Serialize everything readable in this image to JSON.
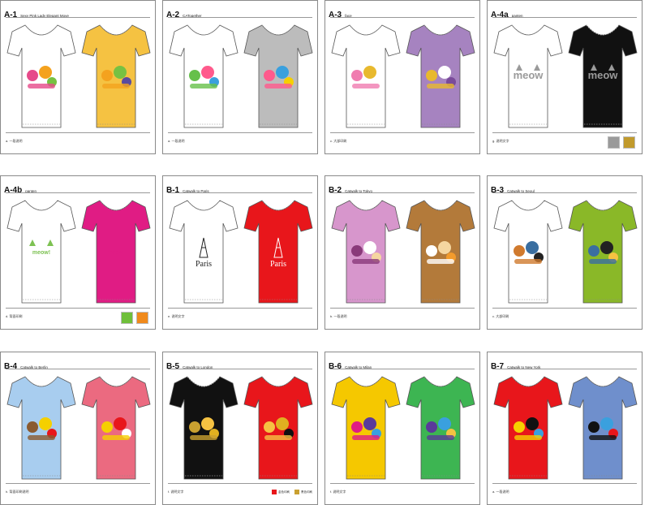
{
  "cards": [
    {
      "code": "A-1",
      "subtitle": "Sexy Pink Lady Elegant Move",
      "footer": "a. 一段说明",
      "shirts": [
        "#ffffff",
        "#f5c242"
      ],
      "art": "flowers"
    },
    {
      "code": "A-2",
      "subtitle": "CATogether",
      "footer": "a. 一段说明",
      "shirts": [
        "#ffffff",
        "#bcbcbc"
      ],
      "art": "cats"
    },
    {
      "code": "A-3",
      "subtitle": "face",
      "footer": "c. 大部印刷",
      "shirts": [
        "#ffffff",
        "#a683c0"
      ],
      "art": "catface"
    },
    {
      "code": "A-4a",
      "subtitle": "panten",
      "footer": "g. 说明文字",
      "shirts": [
        "#ffffff",
        "#111111"
      ],
      "art": "meow",
      "swatches": [
        "#9a9a9a",
        "#c19a2c"
      ]
    },
    {
      "code": "A-4b",
      "subtitle": "panten",
      "footer": "d. 背面印刷",
      "shirts": [
        "#ffffff",
        "#e01c84"
      ],
      "art": "meow2",
      "swatches": [
        "#6fbf3a",
        "#f08a1c"
      ]
    },
    {
      "code": "B-1",
      "subtitle": "Catwalk to Paris",
      "footer": "e. 说明文字",
      "shirts": [
        "#ffffff",
        "#e8161b"
      ],
      "art": "paris"
    },
    {
      "code": "B-2",
      "subtitle": "Catwalk to Tokyo",
      "footer": "b. 一段说明",
      "shirts": [
        "#d796cc",
        "#b37a3a"
      ],
      "art": "tokyo"
    },
    {
      "code": "B-3",
      "subtitle": "Catwalk to Seoul",
      "footer": "c. 大部印刷",
      "shirts": [
        "#ffffff",
        "#8ab828"
      ],
      "art": "seoul"
    },
    {
      "code": "B-4",
      "subtitle": "Catwalk to Berlin",
      "footer": "h. 背面印刷说明",
      "shirts": [
        "#a8cdef",
        "#eb6a80"
      ],
      "art": "berlin"
    },
    {
      "code": "B-5",
      "subtitle": "Catwalk to London",
      "footer": "f. 说明文字",
      "shirts": [
        "#111111",
        "#e8161b"
      ],
      "art": "london",
      "legend": [
        "金色印刷",
        "黑色印刷"
      ]
    },
    {
      "code": "B-6",
      "subtitle": "Catwalk to Milan",
      "footer": "f. 说明文字",
      "shirts": [
        "#f5c800",
        "#3db552"
      ],
      "art": "milan"
    },
    {
      "code": "B-7",
      "subtitle": "Catwalk to New York",
      "footer": "a. 一段说明",
      "shirts": [
        "#e8161b",
        "#6f8fcc"
      ],
      "art": "newyork"
    }
  ]
}
